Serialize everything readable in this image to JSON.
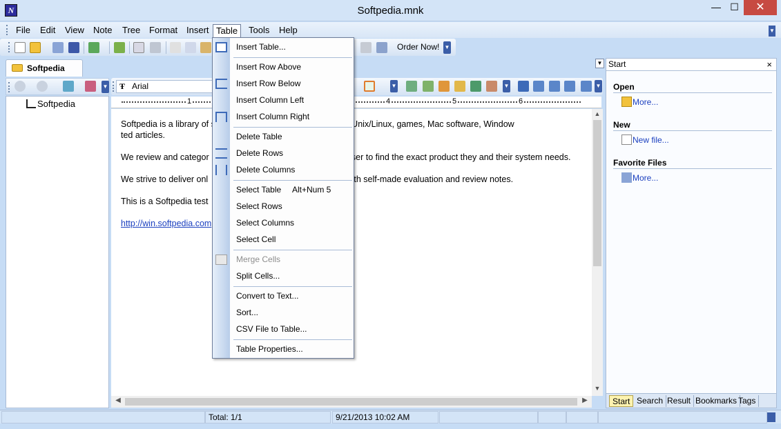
{
  "window": {
    "title": "Softpedia.mnk",
    "app_icon_letter": "N",
    "minimize": "—",
    "maximize": "☐",
    "close": "✕"
  },
  "menu": {
    "items": [
      "File",
      "Edit",
      "View",
      "Note",
      "Tree",
      "Format",
      "Insert",
      "Table",
      "Tools",
      "Help"
    ],
    "active": "Table"
  },
  "toolbar": {
    "order_now": "Order Now!"
  },
  "tree": {
    "tab_label": "Softpedia",
    "nodes": [
      {
        "label": "Softpedia"
      }
    ]
  },
  "format": {
    "font": "Arial",
    "font_icon": "Ŧ"
  },
  "ruler": {
    "numbers": [
      "1",
      "4",
      "5",
      "6"
    ]
  },
  "editor": {
    "paragraphs": [
      "Softpedia is a library of software programs for Windows and Unix/Linux, games, Mac software, Window                                  ted articles.",
      "We review and categor                                         the visitor/user to find the exact product they and their system needs.",
      "We strive to deliver onl                                       er together with self-made evaluation and review notes.",
      "This is a Softpedia test"
    ],
    "link": "http://win.softpedia.com"
  },
  "table_menu": {
    "items": [
      {
        "label": "Insert Table...",
        "icon": "table-icon"
      },
      {
        "label": "Insert Row Above"
      },
      {
        "label": "Insert Row Below",
        "icon": "insert-row-icon"
      },
      {
        "label": "Insert Column Left"
      },
      {
        "label": "Insert Column Right",
        "icon": "insert-column-icon"
      },
      {
        "label": "Delete Table"
      },
      {
        "label": "Delete Rows",
        "icon": "delete-rows-icon"
      },
      {
        "label": "Delete Columns",
        "icon": "delete-columns-icon"
      },
      {
        "label": "Select Table",
        "shortcut": "Alt+Num 5"
      },
      {
        "label": "Select Rows"
      },
      {
        "label": "Select Columns"
      },
      {
        "label": "Select Cell"
      },
      {
        "label": "Merge Cells",
        "icon": "merge-cells-icon",
        "disabled": true
      },
      {
        "label": "Split Cells..."
      },
      {
        "label": "Convert to Text..."
      },
      {
        "label": "Sort..."
      },
      {
        "label": "CSV File to Table..."
      },
      {
        "label": "Table Properties..."
      }
    ]
  },
  "start_pane": {
    "title": "Start",
    "close": "×",
    "sections": [
      {
        "heading": "Open",
        "link": "More..."
      },
      {
        "heading": "New",
        "link": "New file..."
      },
      {
        "heading": "Favorite Files",
        "link": "More..."
      }
    ],
    "tabs": [
      "Start",
      "Search",
      "Result",
      "Bookmarks",
      "Tags"
    ],
    "active_tab": "Start"
  },
  "status": {
    "total": "Total: 1/1",
    "datetime": "9/21/2013 10:02 AM"
  }
}
